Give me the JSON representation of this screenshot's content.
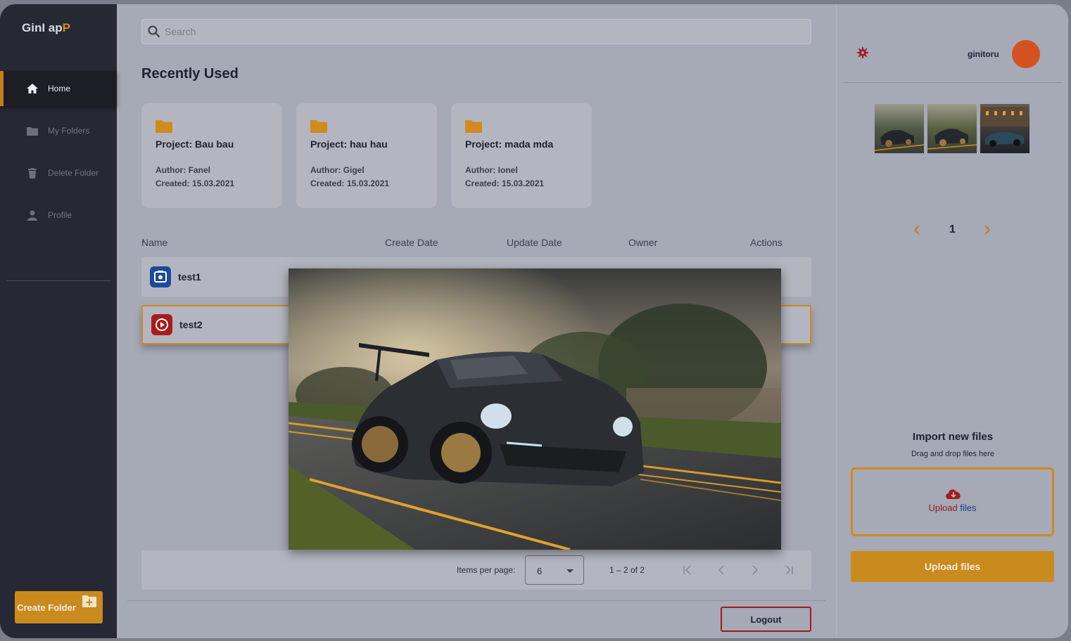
{
  "app": {
    "logo_main": "GinI ap",
    "logo_accent": "P"
  },
  "sidebar": {
    "items": [
      {
        "label": "Home",
        "icon": "home-icon"
      },
      {
        "label": "My Folders",
        "icon": "folder-icon"
      },
      {
        "label": "Delete Folder",
        "icon": "trash-icon"
      },
      {
        "label": "Profile",
        "icon": "person-icon"
      }
    ],
    "create_label": "Create Folder"
  },
  "search": {
    "placeholder": "Search"
  },
  "recent": {
    "title": "Recently Used",
    "cards": [
      {
        "title": "Project: Bau bau",
        "author": "Author: Fanel",
        "created": "Created: 15.03.2021"
      },
      {
        "title": "Project: hau hau",
        "author": "Author: Gigel",
        "created": "Created: 15.03.2021"
      },
      {
        "title": "Project: mada mda",
        "author": "Author: Ionel",
        "created": "Created: 15.03.2021"
      }
    ]
  },
  "table": {
    "headers": {
      "name": "Name",
      "create": "Create Date",
      "update": "Update Date",
      "owner": "Owner",
      "actions": "Actions"
    },
    "rows": [
      {
        "name": "test1",
        "type": "image-file-icon"
      },
      {
        "name": "test2",
        "type": "video-file-icon"
      }
    ]
  },
  "paginator": {
    "items_label": "Items per page:",
    "items_value": "6",
    "range": "1 – 2 of 2"
  },
  "logout_label": "Logout",
  "user": {
    "name": "ginitoru"
  },
  "gallery": {
    "page": "1"
  },
  "import": {
    "title": "Import new files",
    "subtitle": "Drag and drop files here",
    "drop_part1": "Upload",
    "drop_part2": " files",
    "button": "Upload files"
  },
  "colors": {
    "accent": "#c98a1e",
    "sidebar": "#262833",
    "danger": "#a31b1b",
    "avatar": "#d4521f"
  }
}
